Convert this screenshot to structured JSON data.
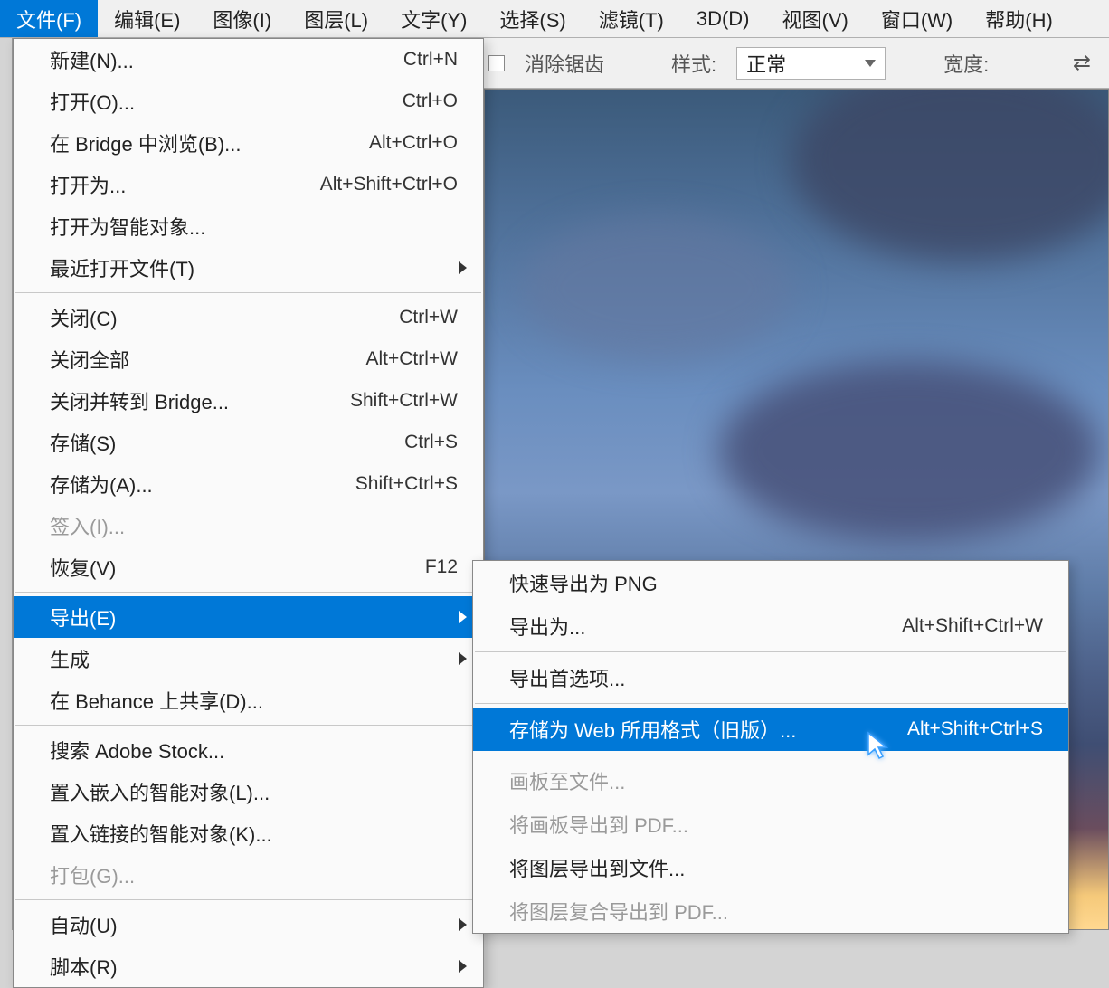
{
  "menubar": [
    {
      "label": "文件(F)",
      "active": true
    },
    {
      "label": "编辑(E)"
    },
    {
      "label": "图像(I)"
    },
    {
      "label": "图层(L)"
    },
    {
      "label": "文字(Y)"
    },
    {
      "label": "选择(S)"
    },
    {
      "label": "滤镜(T)"
    },
    {
      "label": "3D(D)"
    },
    {
      "label": "视图(V)"
    },
    {
      "label": "窗口(W)"
    },
    {
      "label": "帮助(H)"
    }
  ],
  "options_bar": {
    "antialias_label": "消除锯齿",
    "style_label": "样式:",
    "style_value": "正常",
    "width_label": "宽度:"
  },
  "file_menu": {
    "groups": [
      [
        {
          "label": "新建(N)...",
          "shortcut": "Ctrl+N"
        },
        {
          "label": "打开(O)...",
          "shortcut": "Ctrl+O"
        },
        {
          "label": "在 Bridge 中浏览(B)...",
          "shortcut": "Alt+Ctrl+O"
        },
        {
          "label": "打开为...",
          "shortcut": "Alt+Shift+Ctrl+O"
        },
        {
          "label": "打开为智能对象..."
        },
        {
          "label": "最近打开文件(T)",
          "submenu": true
        }
      ],
      [
        {
          "label": "关闭(C)",
          "shortcut": "Ctrl+W"
        },
        {
          "label": "关闭全部",
          "shortcut": "Alt+Ctrl+W"
        },
        {
          "label": "关闭并转到 Bridge...",
          "shortcut": "Shift+Ctrl+W"
        },
        {
          "label": "存储(S)",
          "shortcut": "Ctrl+S"
        },
        {
          "label": "存储为(A)...",
          "shortcut": "Shift+Ctrl+S"
        },
        {
          "label": "签入(I)...",
          "disabled": true
        },
        {
          "label": "恢复(V)",
          "shortcut": "F12"
        }
      ],
      [
        {
          "label": "导出(E)",
          "submenu": true,
          "highlighted": true
        },
        {
          "label": "生成",
          "submenu": true
        },
        {
          "label": "在 Behance 上共享(D)..."
        }
      ],
      [
        {
          "label": "搜索 Adobe Stock..."
        },
        {
          "label": "置入嵌入的智能对象(L)..."
        },
        {
          "label": "置入链接的智能对象(K)..."
        },
        {
          "label": "打包(G)...",
          "disabled": true
        }
      ],
      [
        {
          "label": "自动(U)",
          "submenu": true
        },
        {
          "label": "脚本(R)",
          "submenu": true
        }
      ]
    ]
  },
  "export_submenu": {
    "groups": [
      [
        {
          "label": "快速导出为 PNG"
        },
        {
          "label": "导出为...",
          "shortcut": "Alt+Shift+Ctrl+W"
        }
      ],
      [
        {
          "label": "导出首选项..."
        }
      ],
      [
        {
          "label": "存储为 Web 所用格式（旧版）...",
          "shortcut": "Alt+Shift+Ctrl+S",
          "highlighted": true
        }
      ],
      [
        {
          "label": "画板至文件...",
          "disabled": true
        },
        {
          "label": "将画板导出到 PDF...",
          "disabled": true
        },
        {
          "label": "将图层导出到文件..."
        },
        {
          "label": "将图层复合导出到 PDF...",
          "disabled": true
        }
      ]
    ]
  }
}
